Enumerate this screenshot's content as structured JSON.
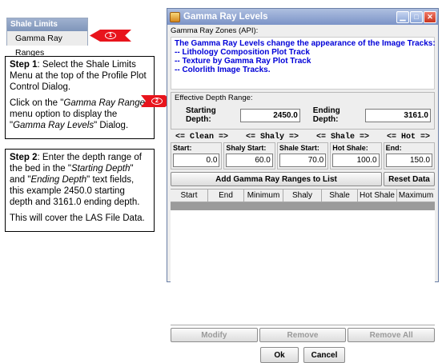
{
  "menu": {
    "title": "Shale Limits",
    "item": "Gamma Ray Ranges",
    "callout1": "1"
  },
  "callout2": "2",
  "step1": {
    "heading": "Step 1",
    "text1": ": Select the Shale Limits Menu at the top of the Profile Plot Control Dialog.",
    "text2a": "Click on the \"",
    "text2b": "Gamma Ray Range",
    "text2c": "\" menu option to display the \"",
    "text2d": "Gamma Ray Levels",
    "text2e": "\" Dialog."
  },
  "step2": {
    "heading": "Step 2",
    "text1a": ": Enter the depth range of the bed in the \"",
    "text1b": "Starting Depth",
    "text1c": "\" and \"",
    "text1d": "Ending Depth",
    "text1e": "\" text fields, this example 2450.0 starting depth and 3161.0 ending depth.",
    "text2": "This will cover the LAS File Data."
  },
  "dialog": {
    "title": "Gamma Ray Levels",
    "zones_label": "Gamma Ray Zones (API):",
    "info": [
      "The Gamma Ray Levels change the appearance of the Image Tracks:",
      "-- Lithology Composition Plot Track",
      "-- Texture by Gamma Ray Plot Track",
      "-- Colorlith Image Tracks."
    ],
    "effective_label": "Effective Depth Range:",
    "starting_label": "Starting Depth:",
    "starting_value": "2450.0",
    "ending_label": "Ending Depth:",
    "ending_value": "3161.0",
    "legend": [
      "<= Clean =>",
      "<= Shaly =>",
      "<= Shale =>",
      "<= Hot =>"
    ],
    "zones": [
      {
        "label": "Start:",
        "value": "0.0"
      },
      {
        "label": "Shaly Start:",
        "value": "60.0"
      },
      {
        "label": "Shale Start:",
        "value": "70.0"
      },
      {
        "label": "Hot Shale:",
        "value": "100.0"
      },
      {
        "label": "End:",
        "value": "150.0"
      }
    ],
    "add_button": "Add Gamma Ray Ranges to List",
    "reset_button": "Reset Data",
    "columns": [
      "Start",
      "End",
      "Minimum",
      "Shaly",
      "Shale",
      "Hot Shale",
      "Maximum"
    ],
    "modify_button": "Modify",
    "remove_button": "Remove",
    "remove_all_button": "Remove All",
    "ok_button": "Ok",
    "cancel_button": "Cancel"
  }
}
